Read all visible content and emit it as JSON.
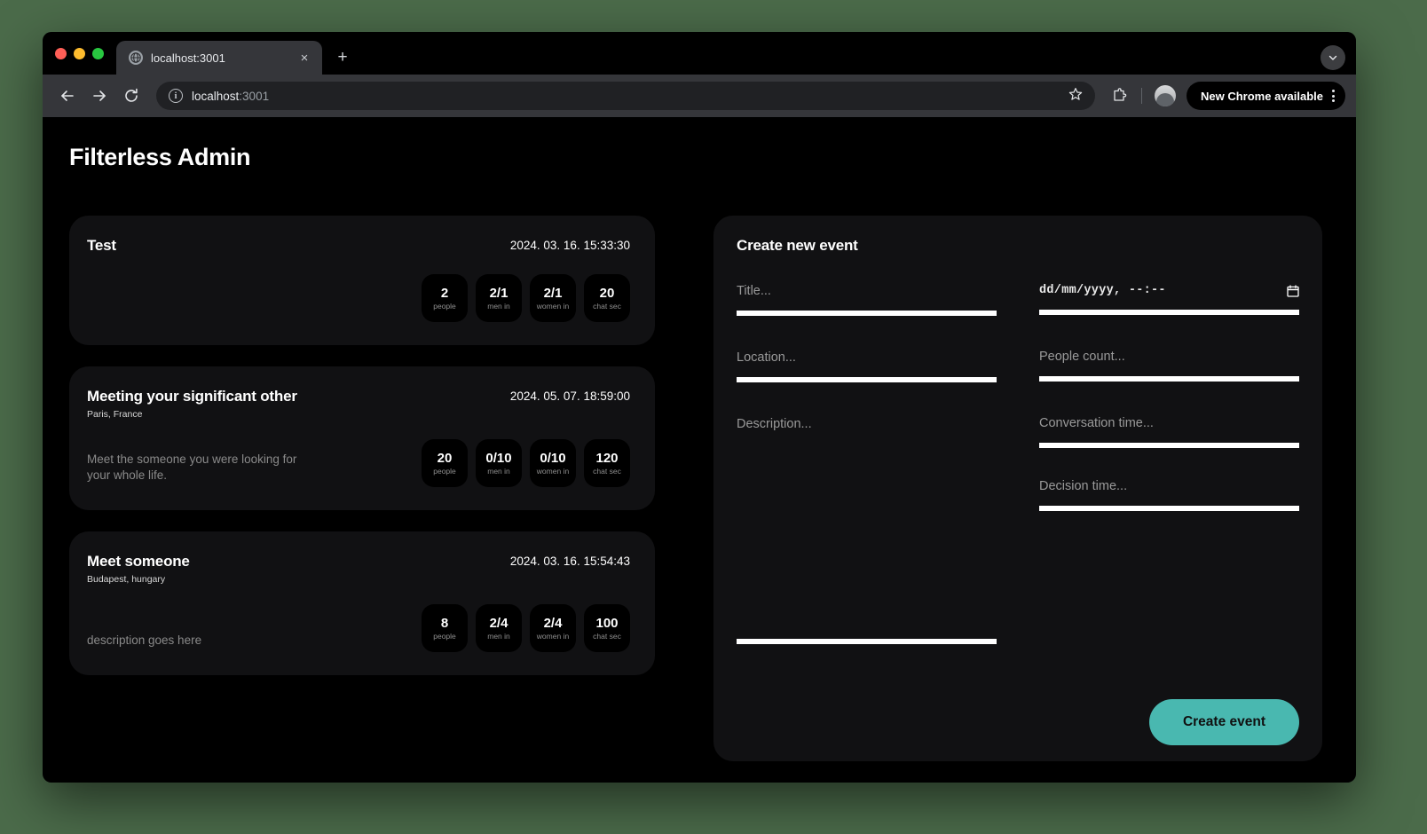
{
  "browser": {
    "tab": {
      "title": "localhost:3001",
      "favicon": "globe-icon",
      "close": "×"
    },
    "new_tab_label": "+",
    "chevron": "⌄",
    "back": "←",
    "forward": "→",
    "reload": "⟳",
    "omnibox": {
      "info": "i",
      "url_host": "localhost",
      "url_rest": ":3001",
      "star": "☆"
    },
    "extensions_icon": "puzzle-icon",
    "profile_avatar": "avatar",
    "update_button": "New Chrome available",
    "menu": "kebab-menu"
  },
  "app": {
    "title": "Filterless Admin"
  },
  "events": [
    {
      "name": "Test",
      "location": "",
      "description": "",
      "date": "2024. 03. 16. 15:33:30",
      "stats": [
        {
          "value": "2",
          "label": "people"
        },
        {
          "value": "2/1",
          "label": "men in"
        },
        {
          "value": "2/1",
          "label": "women in"
        },
        {
          "value": "20",
          "label": "chat sec"
        }
      ]
    },
    {
      "name": "Meeting your significant other",
      "location": "Paris, France",
      "description": "Meet the someone you were looking for your whole life.",
      "date": "2024. 05. 07. 18:59:00",
      "stats": [
        {
          "value": "20",
          "label": "people"
        },
        {
          "value": "0/10",
          "label": "men in"
        },
        {
          "value": "0/10",
          "label": "women in"
        },
        {
          "value": "120",
          "label": "chat sec"
        }
      ]
    },
    {
      "name": "Meet someone",
      "location": "Budapest, hungary",
      "description": "description goes here",
      "date": "2024. 03. 16. 15:54:43",
      "stats": [
        {
          "value": "8",
          "label": "people"
        },
        {
          "value": "2/4",
          "label": "men in"
        },
        {
          "value": "2/4",
          "label": "women in"
        },
        {
          "value": "100",
          "label": "chat sec"
        }
      ]
    }
  ],
  "form": {
    "title": "Create new event",
    "fields": {
      "title_placeholder": "Title...",
      "location_placeholder": "Location...",
      "description_placeholder": "Description...",
      "datetime_placeholder": "dd/mm/yyyy, --:--",
      "people_count_placeholder": "People count...",
      "conversation_time_placeholder": "Conversation time...",
      "decision_time_placeholder": "Decision time..."
    },
    "calendar_icon": "calendar-icon",
    "submit_label": "Create event",
    "accent_color": "#49b8b0"
  }
}
